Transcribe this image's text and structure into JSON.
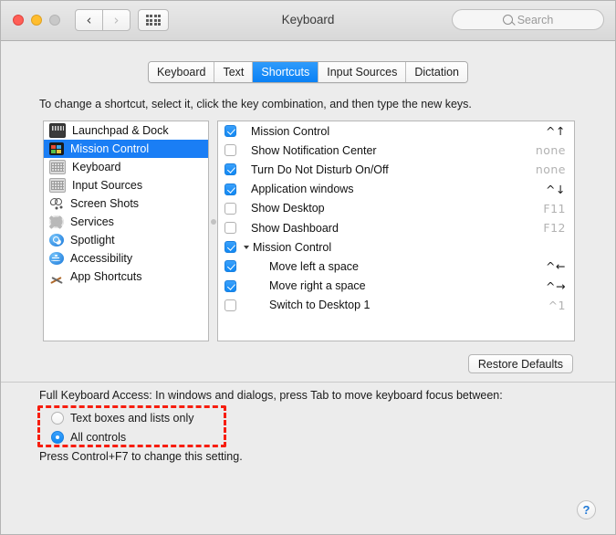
{
  "window": {
    "title": "Keyboard",
    "search_placeholder": "Search",
    "nav_back_icon": "chevron-left-icon",
    "nav_forward_icon": "chevron-right-icon",
    "grid_icon": "grid-view-icon"
  },
  "tabs": [
    {
      "label": "Keyboard",
      "selected": false
    },
    {
      "label": "Text",
      "selected": false
    },
    {
      "label": "Shortcuts",
      "selected": true
    },
    {
      "label": "Input Sources",
      "selected": false
    },
    {
      "label": "Dictation",
      "selected": false
    }
  ],
  "instruction": "To change a shortcut, select it, click the key combination, and then type the new keys.",
  "sidebar": {
    "items": [
      {
        "label": "Launchpad & Dock",
        "icon": "launchpad-dock-icon",
        "selected": false
      },
      {
        "label": "Mission Control",
        "icon": "mission-control-icon",
        "selected": true
      },
      {
        "label": "Keyboard",
        "icon": "keyboard-icon",
        "selected": false
      },
      {
        "label": "Input Sources",
        "icon": "input-sources-icon",
        "selected": false
      },
      {
        "label": "Screen Shots",
        "icon": "screenshot-icon",
        "selected": false
      },
      {
        "label": "Services",
        "icon": "services-gear-icon",
        "selected": false
      },
      {
        "label": "Spotlight",
        "icon": "spotlight-icon",
        "selected": false
      },
      {
        "label": "Accessibility",
        "icon": "accessibility-icon",
        "selected": false
      },
      {
        "label": "App Shortcuts",
        "icon": "app-shortcuts-icon",
        "selected": false
      }
    ]
  },
  "shortcuts": {
    "rows": [
      {
        "label": "Mission Control",
        "key": "^↑",
        "checked": true,
        "level": "top",
        "dim": false,
        "group": false
      },
      {
        "label": "Show Notification Center",
        "key": "none",
        "checked": false,
        "level": "top",
        "dim": true,
        "group": false
      },
      {
        "label": "Turn Do Not Disturb On/Off",
        "key": "none",
        "checked": true,
        "level": "top",
        "dim": true,
        "group": false
      },
      {
        "label": "Application windows",
        "key": "^↓",
        "checked": true,
        "level": "top",
        "dim": false,
        "group": false
      },
      {
        "label": "Show Desktop",
        "key": "F11",
        "checked": false,
        "level": "top",
        "dim": true,
        "group": false
      },
      {
        "label": "Show Dashboard",
        "key": "F12",
        "checked": false,
        "level": "top",
        "dim": true,
        "group": false
      },
      {
        "label": "Mission Control",
        "key": "",
        "checked": true,
        "level": "group",
        "dim": false,
        "group": true
      },
      {
        "label": "Move left a space",
        "key": "^←",
        "checked": true,
        "level": "child",
        "dim": false,
        "group": false
      },
      {
        "label": "Move right a space",
        "key": "^→",
        "checked": true,
        "level": "child",
        "dim": false,
        "group": false
      },
      {
        "label": "Switch to Desktop 1",
        "key": "^1",
        "checked": false,
        "level": "child",
        "dim": true,
        "group": false
      }
    ]
  },
  "restore_defaults_label": "Restore Defaults",
  "full_keyboard_access": {
    "label": "Full Keyboard Access: In windows and dialogs, press Tab to move keyboard focus between:",
    "options": [
      {
        "label": "Text boxes and lists only",
        "selected": false
      },
      {
        "label": "All controls",
        "selected": true
      }
    ],
    "hint": "Press Control+F7 to change this setting."
  },
  "help_label": "?",
  "colors": {
    "accent_blue": "#1a7ef5",
    "annotation_red": "#f71d0e",
    "window_bg": "#ececec"
  }
}
